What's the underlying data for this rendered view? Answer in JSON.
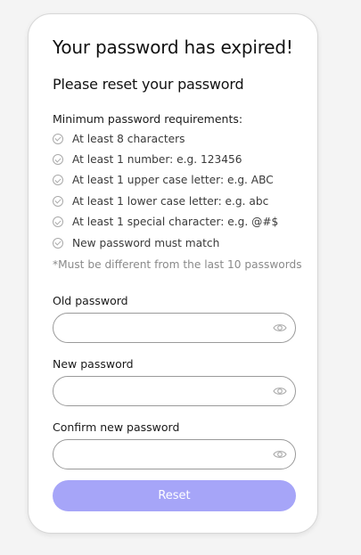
{
  "form": {
    "title": "Your password has expired!",
    "subtitle": "Please reset your password",
    "requirements_heading": "Minimum password requirements:",
    "requirements": [
      {
        "label": "At least 8 characters",
        "icon": "check-circle-icon",
        "met": false
      },
      {
        "label": "At least 1 number: e.g. 123456",
        "icon": "check-circle-icon",
        "met": false
      },
      {
        "label": "At least 1 upper case letter: e.g. ABC",
        "icon": "check-circle-icon",
        "met": false
      },
      {
        "label": "At least 1 lower case letter: e.g. abc",
        "icon": "check-circle-icon",
        "met": false
      },
      {
        "label": "At least 1 special character: e.g. @#$",
        "icon": "check-circle-icon",
        "met": false
      },
      {
        "label": "New password must match",
        "icon": "check-circle-icon",
        "met": false
      }
    ],
    "note": "*Must be different from the last 10 passwords",
    "fields": {
      "old_password": {
        "label": "Old password",
        "value": "",
        "placeholder": "",
        "icon": "eye-icon"
      },
      "new_password": {
        "label": "New password",
        "value": "",
        "placeholder": "",
        "icon": "eye-icon"
      },
      "confirm_password": {
        "label": "Confirm new password",
        "value": "",
        "placeholder": "",
        "icon": "eye-icon"
      }
    },
    "reset_label": "Reset"
  },
  "colors": {
    "button_bg": "#a6a5f8",
    "button_text": "#ffffff",
    "check_icon": "#a9a9a9",
    "page_bg": "#f4f4f4",
    "card_bg": "#ffffff"
  }
}
